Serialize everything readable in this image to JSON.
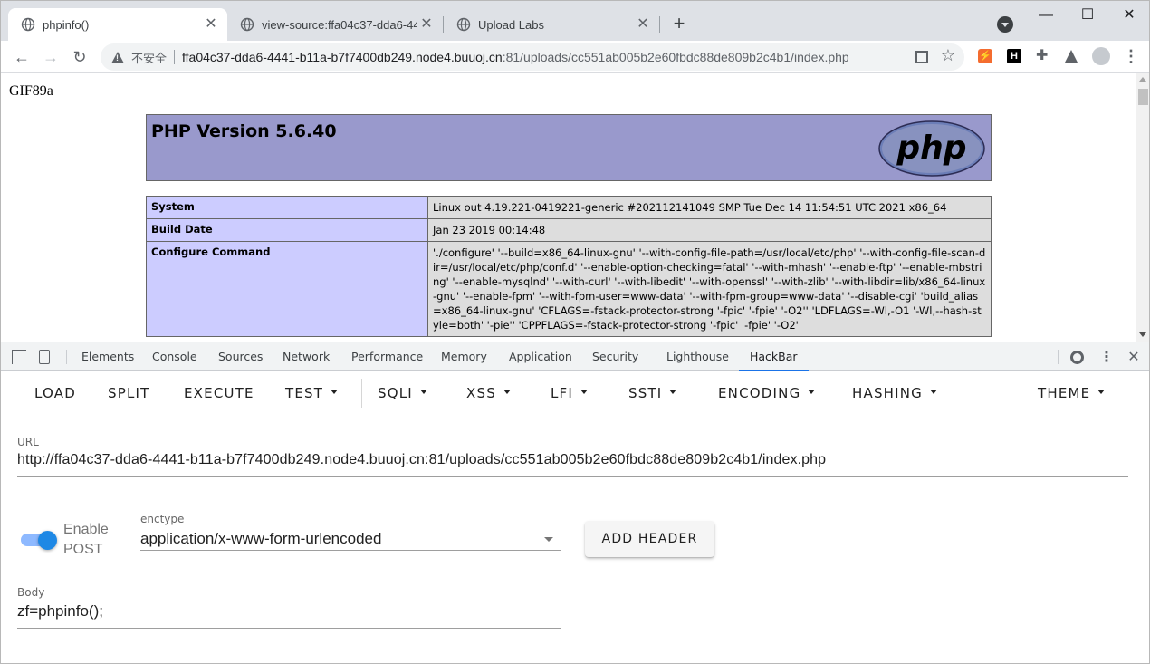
{
  "tabs": [
    {
      "title": "phpinfo()",
      "active": true
    },
    {
      "title": "view-source:ffa04c37-dda6-44",
      "active": false
    },
    {
      "title": "Upload Labs",
      "active": false
    }
  ],
  "toolbar": {
    "security_label": "不安全",
    "url_host": "ffa04c37-dda6-4441-b11a-b7f7400db249.node4.buuoj.cn",
    "url_rest": ":81/uploads/cc551ab005b2e60fbdc88de809b2c4b1/index.php"
  },
  "page": {
    "gif_header": "GIF89a",
    "php_title": "PHP Version 5.6.40",
    "logo_text": "php",
    "rows": [
      {
        "key": "System",
        "value": "Linux out 4.19.221-0419221-generic #202112141049 SMP Tue Dec 14 11:54:51 UTC 2021 x86_64"
      },
      {
        "key": "Build Date",
        "value": "Jan 23 2019 00:14:48"
      },
      {
        "key": "Configure Command",
        "value": "'./configure' '--build=x86_64-linux-gnu' '--with-config-file-path=/usr/local/etc/php' '--with-config-file-scan-dir=/usr/local/etc/php/conf.d' '--enable-option-checking=fatal' '--with-mhash' '--enable-ftp' '--enable-mbstring' '--enable-mysqlnd' '--with-curl' '--with-libedit' '--with-openssl' '--with-zlib' '--with-libdir=lib/x86_64-linux-gnu' '--enable-fpm' '--with-fpm-user=www-data' '--with-fpm-group=www-data' '--disable-cgi' 'build_alias=x86_64-linux-gnu' 'CFLAGS=-fstack-protector-strong '-fpic' '-fpie' '-O2'' 'LDFLAGS=-Wl,-O1 '-Wl,--hash-style=both' '-pie'' 'CPPFLAGS=-fstack-protector-strong '-fpic' '-fpie' '-O2''"
      }
    ]
  },
  "devtools": {
    "tabs": [
      "Elements",
      "Console",
      "Sources",
      "Network",
      "Performance",
      "Memory",
      "Application",
      "Security",
      "Lighthouse",
      "HackBar"
    ],
    "active_tab": "HackBar"
  },
  "hackbar": {
    "menu": {
      "load": "LOAD",
      "split": "SPLIT",
      "execute": "EXECUTE",
      "test": "TEST",
      "sqli": "SQLI",
      "xss": "XSS",
      "lfi": "LFI",
      "ssti": "SSTI",
      "encoding": "ENCODING",
      "hashing": "HASHING",
      "theme": "THEME"
    },
    "url_label": "URL",
    "url_value": "http://ffa04c37-dda6-4441-b11a-b7f7400db249.node4.buuoj.cn:81/uploads/cc551ab005b2e60fbdc88de809b2c4b1/index.php",
    "enable_post_line1": "Enable",
    "enable_post_line2": "POST",
    "enable_post": true,
    "enctype_label": "enctype",
    "enctype_value": "application/x-www-form-urlencoded",
    "add_header_label": "ADD HEADER",
    "body_label": "Body",
    "body_value": "zf=phpinfo();"
  },
  "colors": {
    "php_header_bg": "#9999cc",
    "php_key_bg": "#ccccff",
    "php_value_bg": "#dddddd",
    "switch_on": "#1e88e5",
    "devtools_active": "#1a73e8"
  }
}
